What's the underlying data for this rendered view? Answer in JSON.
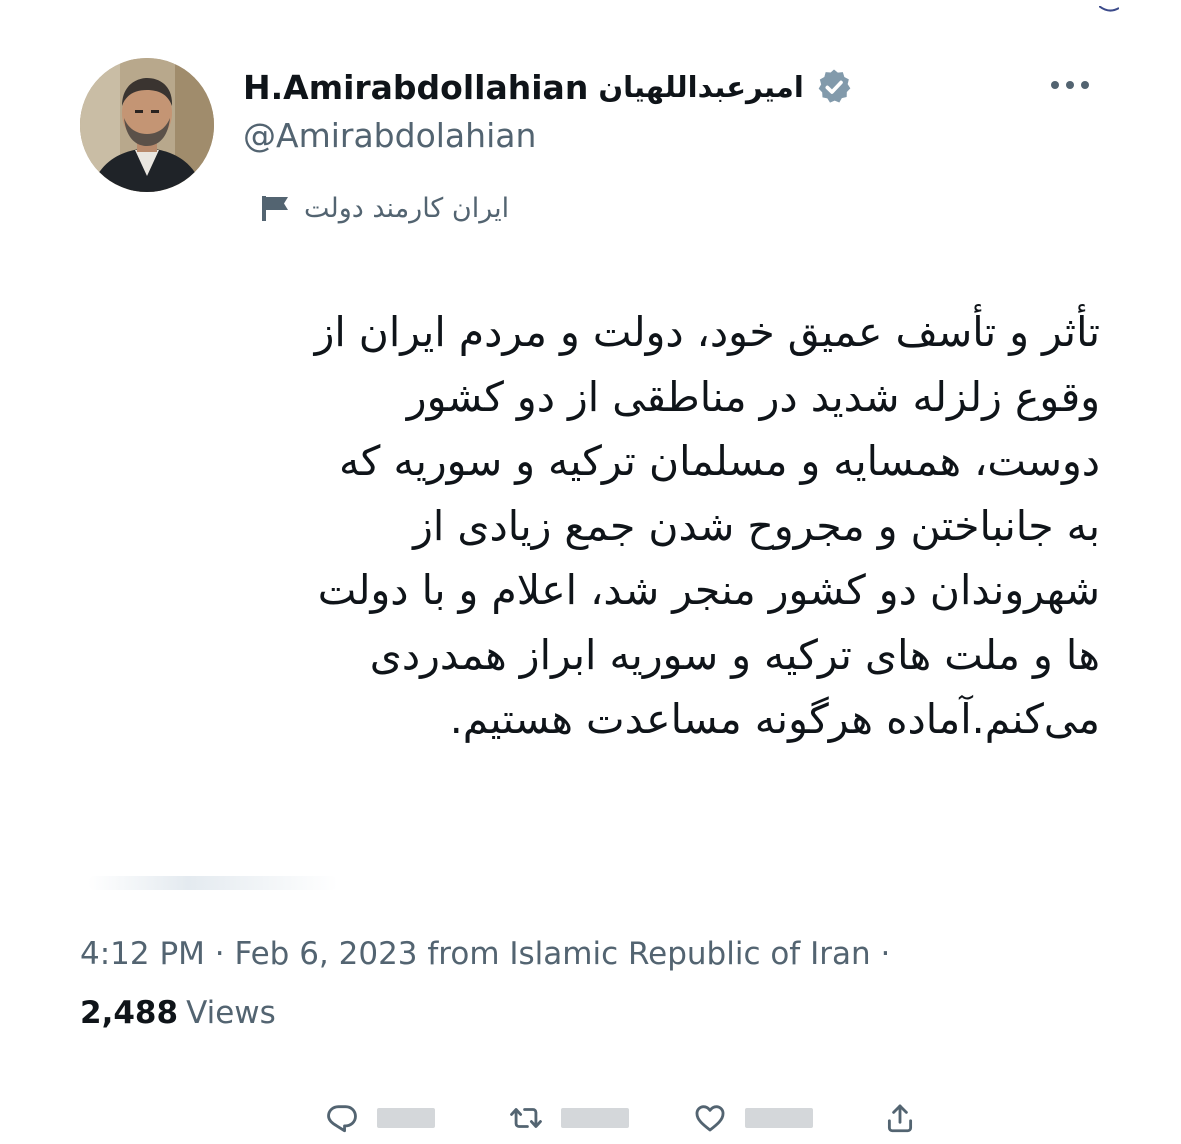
{
  "tweet": {
    "author": {
      "display_name_latin": "H.Amirabdollahian",
      "display_name_persian": "امیرعبداللهیان",
      "handle": "@Amirabdolahian",
      "account_label": "ایران کارمند دولت",
      "avatar_icon": "profile-photo",
      "verified_icon": "verified-badge-icon",
      "label_icon": "flag-icon"
    },
    "more_icon": "more-icon",
    "body_lines": [
      "تأثر و تأسف عمیق خود، دولت و مردم ایران از",
      "وقوع زلزله شدید در مناطقی از دو کشور",
      "دوست، همسایه و مسلمان ترکیه و سوریه که",
      "به جانباختن و مجروح شدن جمع زیادی از",
      "شهروندان دو کشور منجر شد، اعلام و با دولت",
      "ها و ملت های ترکیه و سوریه ابراز همدردی",
      "می‌کنم.آماده هرگونه مساعدت هستیم."
    ],
    "meta": "4:12 PM · Feb 6, 2023 from Islamic Republic of Iran ·",
    "views_count": "2,488",
    "views_label": "Views",
    "actions": [
      {
        "name": "reply",
        "icon": "reply-icon"
      },
      {
        "name": "retweet",
        "icon": "retweet-icon"
      },
      {
        "name": "like",
        "icon": "like-icon"
      },
      {
        "name": "share",
        "icon": "share-icon"
      }
    ],
    "colors": {
      "text_primary": "#0f1419",
      "text_secondary": "#536471",
      "verified_badge": "#829aab",
      "background": "#ffffff"
    }
  }
}
